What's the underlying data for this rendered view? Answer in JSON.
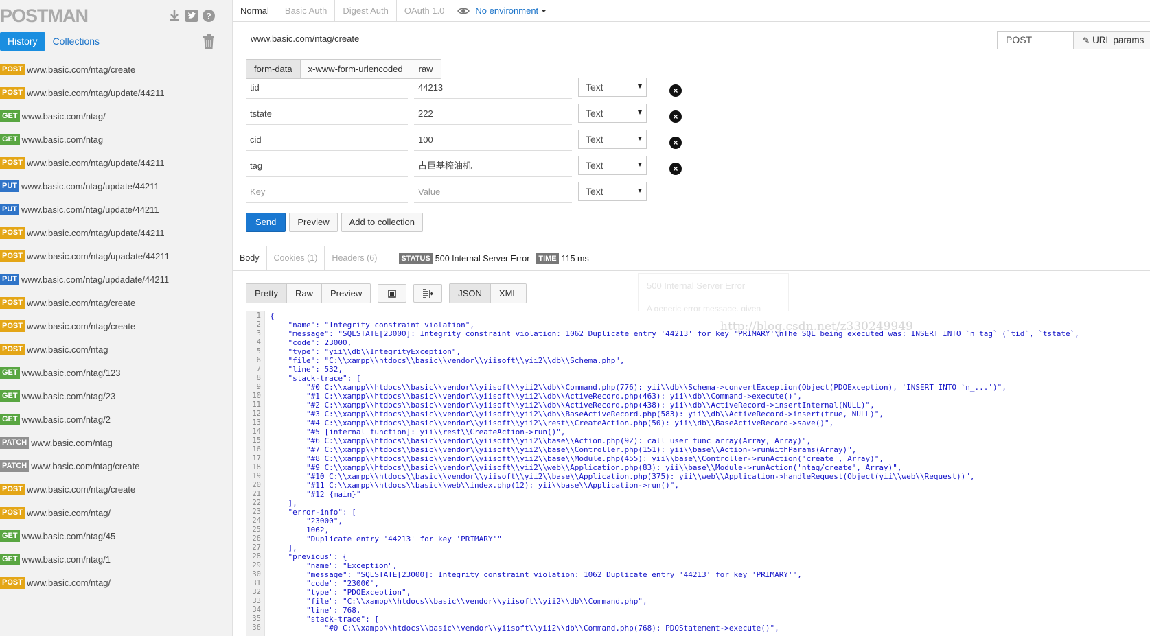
{
  "sidebar": {
    "logo": "POSTMAN",
    "tabs": [
      "History",
      "Collections"
    ],
    "history": [
      {
        "method": "POST",
        "url": "www.basic.com/ntag/create"
      },
      {
        "method": "POST",
        "url": "www.basic.com/ntag/update/44211"
      },
      {
        "method": "GET",
        "url": "www.basic.com/ntag/"
      },
      {
        "method": "GET",
        "url": "www.basic.com/ntag"
      },
      {
        "method": "POST",
        "url": "www.basic.com/ntag/update/44211"
      },
      {
        "method": "PUT",
        "url": "www.basic.com/ntag/update/44211"
      },
      {
        "method": "PUT",
        "url": "www.basic.com/ntag/update/44211"
      },
      {
        "method": "POST",
        "url": "www.basic.com/ntag/update/44211"
      },
      {
        "method": "POST",
        "url": "www.basic.com/ntag/upadate/44211"
      },
      {
        "method": "PUT",
        "url": "www.basic.com/ntag/updadate/44211"
      },
      {
        "method": "POST",
        "url": "www.basic.com/ntag/create"
      },
      {
        "method": "POST",
        "url": "www.basic.com/ntag/create"
      },
      {
        "method": "POST",
        "url": "www.basic.com/ntag"
      },
      {
        "method": "GET",
        "url": "www.basic.com/ntag/123"
      },
      {
        "method": "GET",
        "url": "www.basic.com/ntag/23"
      },
      {
        "method": "GET",
        "url": "www.basic.com/ntag/2"
      },
      {
        "method": "PATCH",
        "url": "www.basic.com/ntag"
      },
      {
        "method": "PATCH",
        "url": "www.basic.com/ntag/create"
      },
      {
        "method": "POST",
        "url": "www.basic.com/ntag/create"
      },
      {
        "method": "POST",
        "url": "www.basic.com/ntag/"
      },
      {
        "method": "GET",
        "url": "www.basic.com/ntag/45"
      },
      {
        "method": "GET",
        "url": "www.basic.com/ntag/1"
      },
      {
        "method": "POST",
        "url": "www.basic.com/ntag/"
      }
    ]
  },
  "auth_tabs": [
    "Normal",
    "Basic Auth",
    "Digest Auth",
    "OAuth 1.0"
  ],
  "environment": "No environment",
  "request": {
    "url": "www.basic.com/ntag/create",
    "method": "POST",
    "url_params_label": "URL params"
  },
  "body_tabs": [
    "form-data",
    "x-www-form-urlencoded",
    "raw"
  ],
  "params": [
    {
      "key": "tid",
      "value": "44213",
      "type": "Text"
    },
    {
      "key": "tstate",
      "value": "222",
      "type": "Text"
    },
    {
      "key": "cid",
      "value": "100",
      "type": "Text"
    },
    {
      "key": "tag",
      "value": "古巨基榨油机",
      "type": "Text"
    }
  ],
  "new_param": {
    "key_placeholder": "Key",
    "value_placeholder": "Value",
    "type": "Text"
  },
  "actions": {
    "send": "Send",
    "preview": "Preview",
    "add": "Add to collection"
  },
  "response": {
    "tabs": [
      "Body",
      "Cookies (1)",
      "Headers (6)"
    ],
    "status_label": "STATUS",
    "status": "500 Internal Server Error",
    "time_label": "TIME",
    "time": "115 ms",
    "view_modes": [
      "Pretty",
      "Raw",
      "Preview"
    ],
    "formats": [
      "JSON",
      "XML"
    ],
    "watermark": "http://blog.csdn.net/z330249949",
    "ghost_title": "500 Internal Server Error",
    "ghost_text": "A generic error message, given",
    "code_lines": [
      "{",
      "    \"name\": \"Integrity constraint violation\",",
      "    \"message\": \"SQLSTATE[23000]: Integrity constraint violation: 1062 Duplicate entry '44213' for key 'PRIMARY'\\nThe SQL being executed was: INSERT INTO `n_tag` (`tid`, `tstate`,",
      "    \"code\": 23000,",
      "    \"type\": \"yii\\\\db\\\\IntegrityException\",",
      "    \"file\": \"C:\\\\xampp\\\\htdocs\\\\basic\\\\vendor\\\\yiisoft\\\\yii2\\\\db\\\\Schema.php\",",
      "    \"line\": 532,",
      "    \"stack-trace\": [",
      "        \"#0 C:\\\\xampp\\\\htdocs\\\\basic\\\\vendor\\\\yiisoft\\\\yii2\\\\db\\\\Command.php(776): yii\\\\db\\\\Schema->convertException(Object(PDOException), 'INSERT INTO `n_...')\",",
      "        \"#1 C:\\\\xampp\\\\htdocs\\\\basic\\\\vendor\\\\yiisoft\\\\yii2\\\\db\\\\ActiveRecord.php(463): yii\\\\db\\\\Command->execute()\",",
      "        \"#2 C:\\\\xampp\\\\htdocs\\\\basic\\\\vendor\\\\yiisoft\\\\yii2\\\\db\\\\ActiveRecord.php(438): yii\\\\db\\\\ActiveRecord->insertInternal(NULL)\",",
      "        \"#3 C:\\\\xampp\\\\htdocs\\\\basic\\\\vendor\\\\yiisoft\\\\yii2\\\\db\\\\BaseActiveRecord.php(583): yii\\\\db\\\\ActiveRecord->insert(true, NULL)\",",
      "        \"#4 C:\\\\xampp\\\\htdocs\\\\basic\\\\vendor\\\\yiisoft\\\\yii2\\\\rest\\\\CreateAction.php(50): yii\\\\db\\\\BaseActiveRecord->save()\",",
      "        \"#5 [internal function]: yii\\\\rest\\\\CreateAction->run()\",",
      "        \"#6 C:\\\\xampp\\\\htdocs\\\\basic\\\\vendor\\\\yiisoft\\\\yii2\\\\base\\\\Action.php(92): call_user_func_array(Array, Array)\",",
      "        \"#7 C:\\\\xampp\\\\htdocs\\\\basic\\\\vendor\\\\yiisoft\\\\yii2\\\\base\\\\Controller.php(151): yii\\\\base\\\\Action->runWithParams(Array)\",",
      "        \"#8 C:\\\\xampp\\\\htdocs\\\\basic\\\\vendor\\\\yiisoft\\\\yii2\\\\base\\\\Module.php(455): yii\\\\base\\\\Controller->runAction('create', Array)\",",
      "        \"#9 C:\\\\xampp\\\\htdocs\\\\basic\\\\vendor\\\\yiisoft\\\\yii2\\\\web\\\\Application.php(83): yii\\\\base\\\\Module->runAction('ntag/create', Array)\",",
      "        \"#10 C:\\\\xampp\\\\htdocs\\\\basic\\\\vendor\\\\yiisoft\\\\yii2\\\\base\\\\Application.php(375): yii\\\\web\\\\Application->handleRequest(Object(yii\\\\web\\\\Request))\",",
      "        \"#11 C:\\\\xampp\\\\htdocs\\\\basic\\\\web\\\\index.php(12): yii\\\\base\\\\Application->run()\",",
      "        \"#12 {main}\"",
      "    ],",
      "    \"error-info\": [",
      "        \"23000\",",
      "        1062,",
      "        \"Duplicate entry '44213' for key 'PRIMARY'\"",
      "    ],",
      "    \"previous\": {",
      "        \"name\": \"Exception\",",
      "        \"message\": \"SQLSTATE[23000]: Integrity constraint violation: 1062 Duplicate entry '44213' for key 'PRIMARY'\",",
      "        \"code\": \"23000\",",
      "        \"type\": \"PDOException\",",
      "        \"file\": \"C:\\\\xampp\\\\htdocs\\\\basic\\\\vendor\\\\yiisoft\\\\yii2\\\\db\\\\Command.php\",",
      "        \"line\": 768,",
      "        \"stack-trace\": [",
      "            \"#0 C:\\\\xampp\\\\htdocs\\\\basic\\\\vendor\\\\yiisoft\\\\yii2\\\\db\\\\Command.php(768): PDOStatement->execute()\","
    ]
  },
  "colors": {
    "POST": "#e4a617",
    "GET": "#59a642",
    "PUT": "#2f74c8",
    "PATCH": "#909090",
    "accent": "#1a8ee0",
    "code": "#1515c8"
  },
  "icons": [
    "download-icon",
    "twitter-icon",
    "help-icon",
    "trash-icon",
    "eye-icon",
    "edit-icon",
    "remove-icon",
    "fullscreen-icon",
    "indent-icon"
  ]
}
